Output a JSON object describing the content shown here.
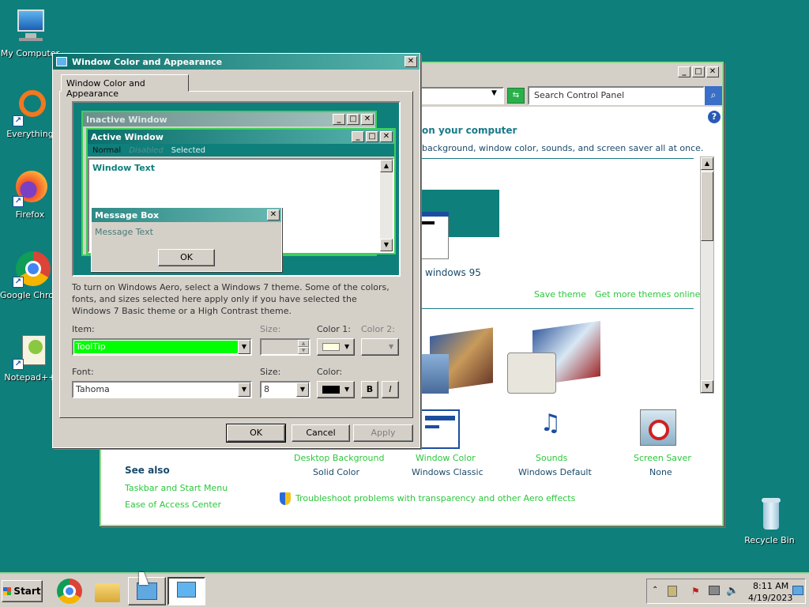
{
  "desktop": {
    "icons": [
      {
        "label": "My Computer",
        "icon": "computer-icon"
      },
      {
        "label": "Everything",
        "icon": "search-ring-icon"
      },
      {
        "label": "Firefox",
        "icon": "firefox-icon"
      },
      {
        "label": "Google Chrome",
        "icon": "chrome-icon"
      },
      {
        "label": "Notepad++",
        "icon": "notepad-icon"
      },
      {
        "label": "Recycle Bin",
        "icon": "recycle-bin-icon"
      }
    ]
  },
  "control_panel": {
    "search_placeholder": "Search Control Panel",
    "heading": "on your computer",
    "subheading": "background, window color, sounds, and screen saver all at once.",
    "theme_name": "windows 95",
    "save_theme": "Save theme",
    "more_themes": "Get more themes online",
    "settings": [
      {
        "title": "Desktop Background",
        "value": "Solid Color"
      },
      {
        "title": "Window Color",
        "value": "Windows Classic"
      },
      {
        "title": "Sounds",
        "value": "Windows Default"
      },
      {
        "title": "Screen Saver",
        "value": "None"
      }
    ],
    "see_also": "See also",
    "links": [
      "Taskbar and Start Menu",
      "Ease of Access Center"
    ],
    "troubleshoot": "Troubleshoot problems with transparency and other Aero effects"
  },
  "dialog": {
    "title": "Window Color and Appearance",
    "tab": "Window Color and Appearance",
    "preview": {
      "inactive_title": "Inactive Window",
      "active_title": "Active Window",
      "menu": [
        "Normal",
        "Disabled",
        "Selected"
      ],
      "window_text": "Window Text",
      "msgbox_title": "Message Box",
      "msgbox_text": "Message Text",
      "msgbox_ok": "OK"
    },
    "description": "To turn on Windows Aero, select a Windows 7 theme.  Some of the colors, fonts, and sizes selected here apply only if you have selected the Windows 7 Basic theme or a High Contrast theme.",
    "labels": {
      "item": "Item:",
      "size": "Size:",
      "color1": "Color 1:",
      "color2": "Color 2:",
      "font": "Font:",
      "font_size": "Size:",
      "color": "Color:"
    },
    "item_value": "ToolTip",
    "font_value": "Tahoma",
    "font_size_value": "8",
    "bold": "B",
    "italic": "I",
    "ok": "OK",
    "cancel": "Cancel",
    "apply": "Apply"
  },
  "taskbar": {
    "start": "Start",
    "time": "8:11 AM",
    "date": "4/19/2023"
  },
  "colors": {
    "desktop": "#0e7f7b",
    "accent_green": "#2cc73c",
    "item_highlight": "#00ff00"
  }
}
